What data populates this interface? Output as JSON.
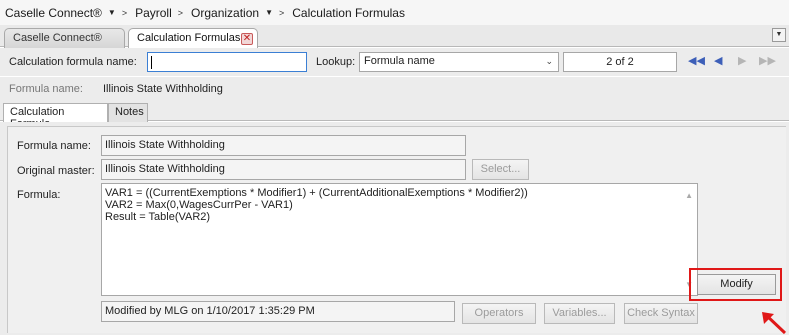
{
  "breadcrumb": {
    "items": [
      {
        "label": "Caselle Connect®"
      },
      {
        "label": "Payroll"
      },
      {
        "label": "Organization"
      },
      {
        "label": "Calculation Formulas"
      }
    ],
    "separator": ">"
  },
  "tabs": {
    "items": [
      {
        "label": "Caselle Connect®",
        "active": false
      },
      {
        "label": "Calculation Formulas",
        "active": true,
        "close_icon": "close-icon"
      }
    ],
    "menu_icon": "chevron-down-icon"
  },
  "lookup_bar": {
    "name_label": "Calculation formula name:",
    "name_value": "",
    "lookup_label": "Lookup:",
    "lookup_selected": "Formula name",
    "page_status": "2 of 2",
    "nav_icons": [
      "first-page-icon",
      "previous-page-icon",
      "next-page-icon",
      "last-page-icon"
    ]
  },
  "formula_header": {
    "label": "Formula name:",
    "value": "Illinois State Withholding"
  },
  "subtabs": {
    "items": [
      {
        "label": "Calculation Formula",
        "active": true
      },
      {
        "label": "Notes",
        "active": false
      }
    ]
  },
  "form": {
    "formula_name_label": "Formula name:",
    "formula_name_value": "Illinois State Withholding",
    "original_master_label": "Original master:",
    "original_master_value": "Illinois State Withholding",
    "select_button": "Select...",
    "formula_label": "Formula:",
    "formula_lines": [
      "VAR1 = ((CurrentExemptions * Modifier1) + (CurrentAdditionalExemptions * Modifier2))",
      "VAR2 = Max(0,WagesCurrPer - VAR1)",
      "Result = Table(VAR2)"
    ],
    "modify_button": "Modify",
    "modified_status": "Modified by MLG on 1/10/2017 1:35:29 PM",
    "operators_button": "Operators",
    "variables_button": "Variables...",
    "check_syntax_button": "Check Syntax"
  },
  "colors": {
    "highlight": "#e01818",
    "nav_active": "#3d5fb8",
    "nav_disabled": "#b5b5b5"
  }
}
